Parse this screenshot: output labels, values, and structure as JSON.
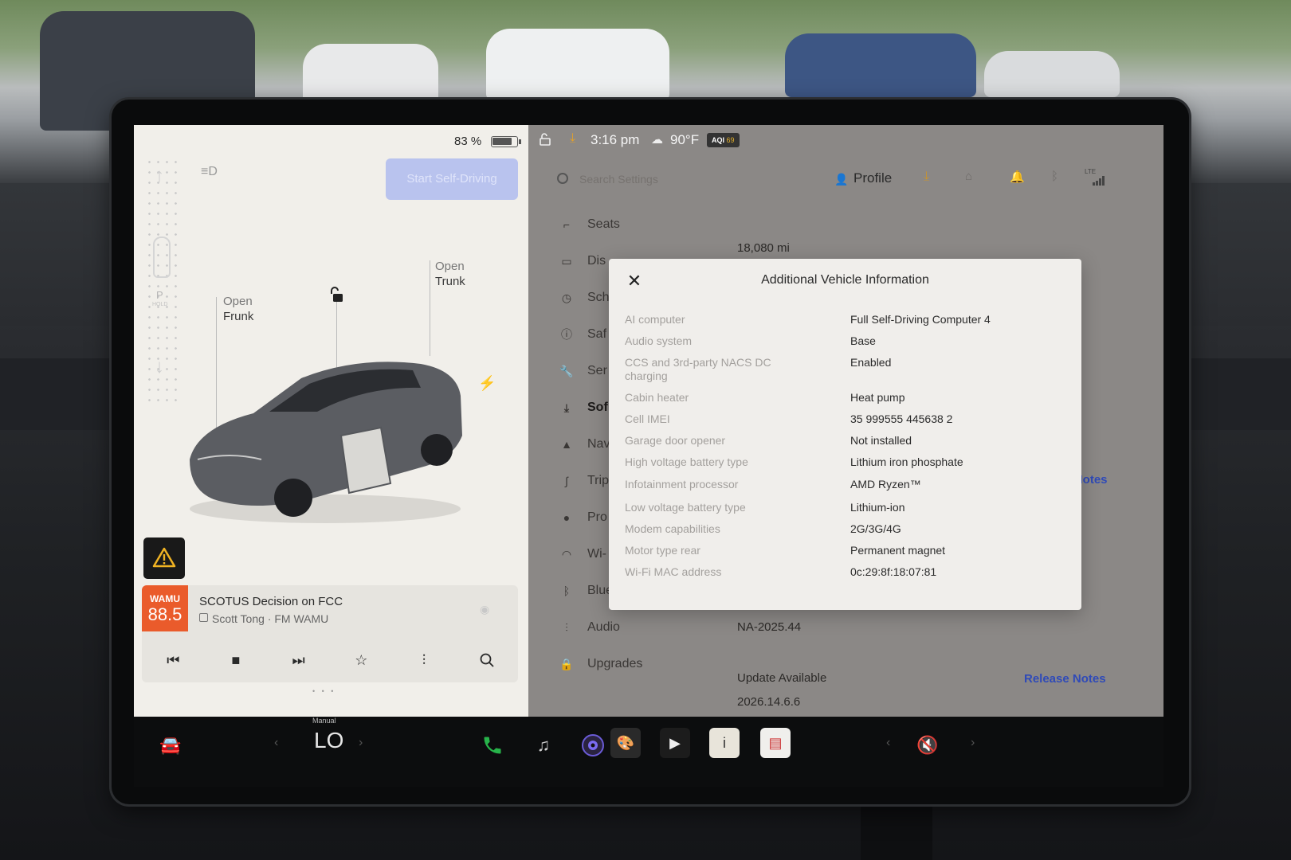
{
  "left": {
    "battery_percent_text": "83 %",
    "battery_level": 0.83,
    "fsd_button_label": "Start Self-Driving",
    "gear_p": "P",
    "gear_hold": "HOLD",
    "frunk": {
      "line1": "Open",
      "line2": "Frunk"
    },
    "trunk": {
      "line1": "Open",
      "line2": "Trunk"
    }
  },
  "media": {
    "station_name": "WAMU",
    "station_freq": "88.5",
    "title": "SCOTUS Decision on FCC",
    "subtitle": "Scott Tong · FM WAMU",
    "page_dots": "• • •"
  },
  "status": {
    "time": "3:16 pm",
    "temperature": "90°F",
    "aqi_label": "AQI",
    "aqi_value": "69"
  },
  "topbar": {
    "search_placeholder": "Search Settings",
    "profile_label": "Profile",
    "lte_label": "LTE"
  },
  "menu": {
    "items": [
      {
        "label": "Seats",
        "icon": "seat-icon"
      },
      {
        "label": "Dis",
        "icon": "display-icon"
      },
      {
        "label": "Sch",
        "icon": "schedule-icon"
      },
      {
        "label": "Saf",
        "icon": "safety-icon"
      },
      {
        "label": "Ser",
        "icon": "wrench-icon"
      },
      {
        "label": "Sof",
        "icon": "download-icon",
        "selected": true
      },
      {
        "label": "Nav",
        "icon": "navigation-icon"
      },
      {
        "label": "Trip",
        "icon": "trips-icon"
      },
      {
        "label": "Pro",
        "icon": "profile-icon"
      },
      {
        "label": "Wi-",
        "icon": "wifi-icon"
      },
      {
        "label": "Bluetooth",
        "icon": "bluetooth-icon"
      },
      {
        "label": "Audio",
        "icon": "audio-icon"
      },
      {
        "label": "Upgrades",
        "icon": "lock-icon"
      }
    ]
  },
  "software": {
    "odometer": "18,080 mi",
    "release_notes_partial": "se Notes",
    "current_version": "NA-2025.44",
    "update_status": "Update Available",
    "release_notes": "Release Notes",
    "new_version": "2026.14.6.6"
  },
  "modal": {
    "title": "Additional Vehicle Information",
    "rows": [
      {
        "k": "AI computer",
        "v": "Full Self-Driving Computer 4"
      },
      {
        "k": "Audio system",
        "v": "Base"
      },
      {
        "k": "CCS and 3rd-party NACS DC charging",
        "v": "Enabled"
      },
      {
        "k": "Cabin heater",
        "v": "Heat pump"
      },
      {
        "k": "Cell IMEI",
        "v": "35 999555 445638 2"
      },
      {
        "k": "Garage door opener",
        "v": "Not installed"
      },
      {
        "k": "High voltage battery type",
        "v": "Lithium iron phosphate"
      },
      {
        "k": "Infotainment processor",
        "v": "AMD Ryzen™"
      },
      {
        "k": "Low voltage battery type",
        "v": "Lithium-ion"
      },
      {
        "k": "Modem capabilities",
        "v": "2G/3G/4G"
      },
      {
        "k": "Motor type rear",
        "v": "Permanent magnet"
      },
      {
        "k": "Wi-Fi MAC address",
        "v": "0c:29:8f:18:07:81"
      }
    ]
  },
  "dock": {
    "climate_mode": "Manual",
    "climate_temp": "LO"
  },
  "colors": {
    "accent_blue": "#2f4ab8",
    "download_orange": "#e3a12b",
    "station_orange": "#ea5b2b",
    "phone_green": "#27b34a"
  }
}
